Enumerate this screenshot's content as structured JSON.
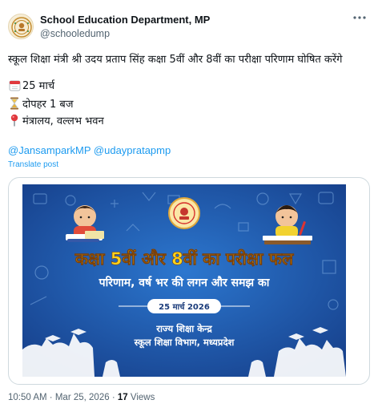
{
  "author": {
    "name": "School Education Department, MP",
    "handle": "@schooledump"
  },
  "tweet": {
    "text": "स्कूल शिक्षा मंत्री श्री उदय प्रताप सिंह कक्षा 5वीं और 8वीं का परीक्षा परिणाम घोषित करेंगे",
    "date_line": "25 मार्च",
    "time_line": "दोपहर 1 बज",
    "place_line": "मंत्रालय, वल्लभ भवन",
    "mentions": [
      "@JansamparkMP",
      "@udaypratapmp"
    ],
    "translate_label": "Translate post"
  },
  "poster": {
    "headline": "कक्षा 5वीं और 8वीं का परीक्षा फल",
    "subline": "परिणाम, वर्ष भर की लगन और समझ का",
    "date": "25 मार्च 2026",
    "org_line1": "राज्य शिक्षा केन्द्र",
    "org_line2": "स्कूल शिक्षा विभाग, मध्यप्रदेश"
  },
  "meta": {
    "time": "10:50 AM",
    "separator": "·",
    "date": "Mar 25, 2026",
    "views_count": "17",
    "views_label": "Views"
  },
  "icons": {
    "more": "more-horizontal-icon",
    "calendar": "calendar-icon",
    "hourglass": "hourglass-icon",
    "pin": "location-pin-icon"
  },
  "colors": {
    "link": "#1d9bf0",
    "muted": "#536471",
    "poster_bg": "#1f5fb0",
    "poster_headline": "#ffd21a"
  }
}
